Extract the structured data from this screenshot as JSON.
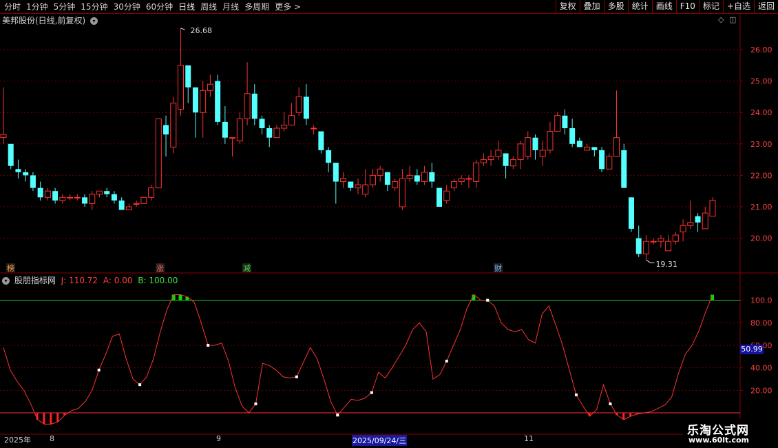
{
  "toolbar": {
    "periods": [
      "分时",
      "1分钟",
      "5分钟",
      "15分钟",
      "30分钟",
      "60分钟",
      "日线",
      "周线",
      "月线",
      "多周期",
      "更多 >"
    ],
    "active_period": "日线",
    "right_buttons": [
      "复权",
      "叠加",
      "多股",
      "统计",
      "画线",
      "F10",
      "标记",
      "+自选",
      "返回"
    ]
  },
  "stock_title": "美邦股份(日线,前复权)",
  "main_chart": {
    "y_ticks": [
      "26.00",
      "25.00",
      "24.00",
      "23.00",
      "22.00",
      "21.00",
      "20.00"
    ],
    "high_label": "26.68",
    "low_label": "19.31",
    "markers": [
      {
        "text": "榜",
        "color": "#ff9c3a"
      },
      {
        "text": "涨",
        "color": "#ff6060"
      },
      {
        "text": "减",
        "color": "#40e040"
      },
      {
        "text": "财",
        "color": "#7ab0ff"
      }
    ],
    "colors": {
      "up": "#ff3232",
      "down": "#54ffff",
      "grid": "#700000"
    },
    "candles": [
      [
        23.2,
        23.3,
        24.8,
        23.0
      ],
      [
        23.0,
        22.3,
        23.0,
        22.2
      ],
      [
        22.2,
        22.1,
        22.5,
        21.9
      ],
      [
        22.1,
        22.0,
        22.2,
        21.8
      ],
      [
        22.0,
        21.6,
        22.1,
        21.5
      ],
      [
        21.6,
        21.3,
        21.8,
        21.2
      ],
      [
        21.3,
        21.5,
        21.6,
        21.2
      ],
      [
        21.5,
        21.2,
        21.6,
        21.1
      ],
      [
        21.2,
        21.3,
        21.4,
        21.1
      ],
      [
        21.3,
        21.3,
        21.4,
        21.2
      ],
      [
        21.3,
        21.3,
        21.4,
        21.2
      ],
      [
        21.3,
        21.1,
        21.4,
        21.0
      ],
      [
        21.1,
        21.4,
        21.5,
        20.9
      ],
      [
        21.4,
        21.5,
        21.5,
        21.3
      ],
      [
        21.5,
        21.4,
        21.6,
        21.3
      ],
      [
        21.4,
        21.2,
        21.5,
        21.1
      ],
      [
        21.2,
        20.9,
        21.3,
        20.9
      ],
      [
        20.9,
        21.0,
        21.1,
        20.9
      ],
      [
        21.1,
        21.1,
        21.2,
        21.0
      ],
      [
        21.1,
        21.3,
        21.3,
        21.1
      ],
      [
        21.3,
        21.6,
        21.7,
        21.2
      ],
      [
        21.6,
        23.8,
        23.8,
        21.6
      ],
      [
        23.6,
        23.3,
        23.9,
        22.6
      ],
      [
        22.9,
        24.3,
        24.5,
        22.7
      ],
      [
        24.1,
        25.5,
        26.68,
        23.9
      ],
      [
        25.5,
        24.8,
        25.3,
        24.3
      ],
      [
        24.8,
        24.0,
        24.7,
        23.2
      ],
      [
        24.0,
        24.7,
        25.0,
        23.2
      ],
      [
        24.7,
        24.9,
        25.2,
        24.5
      ],
      [
        25.0,
        23.7,
        25.2,
        23.6
      ],
      [
        23.7,
        23.2,
        24.2,
        23.0
      ],
      [
        23.2,
        23.2,
        23.2,
        22.6
      ],
      [
        23.1,
        23.8,
        24.0,
        23.0
      ],
      [
        23.8,
        24.6,
        25.6,
        23.6
      ],
      [
        24.6,
        23.8,
        24.9,
        23.6
      ],
      [
        23.8,
        23.5,
        23.9,
        23.3
      ],
      [
        23.5,
        23.2,
        23.6,
        22.9
      ],
      [
        23.2,
        23.5,
        23.6,
        23.3
      ],
      [
        23.5,
        23.6,
        24.0,
        23.4
      ],
      [
        23.6,
        23.9,
        24.3,
        23.6
      ],
      [
        24.0,
        24.5,
        24.8,
        23.9
      ],
      [
        24.5,
        23.8,
        24.9,
        23.6
      ],
      [
        23.5,
        23.5,
        23.6,
        23.3
      ],
      [
        23.4,
        22.8,
        23.4,
        22.7
      ],
      [
        22.8,
        22.4,
        22.9,
        22.1
      ],
      [
        22.4,
        21.8,
        22.4,
        21.1
      ],
      [
        21.8,
        21.9,
        22.1,
        21.6
      ],
      [
        21.8,
        21.6,
        21.8,
        21.5
      ],
      [
        21.6,
        21.7,
        21.9,
        21.4
      ],
      [
        21.4,
        21.7,
        22.2,
        21.3
      ],
      [
        21.7,
        22.0,
        22.2,
        21.6
      ],
      [
        22.0,
        22.2,
        22.3,
        21.8
      ],
      [
        22.1,
        21.7,
        22.1,
        21.5
      ],
      [
        21.6,
        21.8,
        21.9,
        21.5
      ],
      [
        21.0,
        21.9,
        22.2,
        20.9
      ],
      [
        21.9,
        22.0,
        22.3,
        21.8
      ],
      [
        22.0,
        21.8,
        22.2,
        21.7
      ],
      [
        21.8,
        22.1,
        22.3,
        21.7
      ],
      [
        22.1,
        21.8,
        22.4,
        21.6
      ],
      [
        21.6,
        21.0,
        21.6,
        21.0
      ],
      [
        21.2,
        21.5,
        21.7,
        21.1
      ],
      [
        21.6,
        21.8,
        21.9,
        21.5
      ],
      [
        21.8,
        21.9,
        22.0,
        21.7
      ],
      [
        21.9,
        21.9,
        22.0,
        21.6
      ],
      [
        21.8,
        22.4,
        22.5,
        21.6
      ],
      [
        22.4,
        22.5,
        22.7,
        22.3
      ],
      [
        22.5,
        22.6,
        22.8,
        22.3
      ],
      [
        22.6,
        22.8,
        23.1,
        22.5
      ],
      [
        22.7,
        22.3,
        22.7,
        21.9
      ],
      [
        22.3,
        22.5,
        22.6,
        22.2
      ],
      [
        22.5,
        23.0,
        23.1,
        22.2
      ],
      [
        22.6,
        23.2,
        23.4,
        22.5
      ],
      [
        23.2,
        22.8,
        23.3,
        22.5
      ],
      [
        22.6,
        22.8,
        23.1,
        22.3
      ],
      [
        22.8,
        23.4,
        23.7,
        22.7
      ],
      [
        23.4,
        23.9,
        24.0,
        23.4
      ],
      [
        23.9,
        23.5,
        24.1,
        23.3
      ],
      [
        23.5,
        23.0,
        23.8,
        22.9
      ],
      [
        23.1,
        22.9,
        23.2,
        22.9
      ],
      [
        22.8,
        22.9,
        23.0,
        22.8
      ],
      [
        22.9,
        22.8,
        22.9,
        22.6
      ],
      [
        22.8,
        22.2,
        22.9,
        22.1
      ],
      [
        22.2,
        22.6,
        22.7,
        22.2
      ],
      [
        22.6,
        23.2,
        24.7,
        22.6
      ],
      [
        22.8,
        21.6,
        23.0,
        21.6
      ],
      [
        21.3,
        20.3,
        21.3,
        20.2
      ],
      [
        20.0,
        19.5,
        20.4,
        19.4
      ],
      [
        19.5,
        19.9,
        20.1,
        19.31
      ],
      [
        19.9,
        19.9,
        20.0,
        19.8
      ],
      [
        19.9,
        20.0,
        20.1,
        19.7
      ],
      [
        19.6,
        19.9,
        20.1,
        19.6
      ],
      [
        19.9,
        20.1,
        20.2,
        19.8
      ],
      [
        20.2,
        20.4,
        20.6,
        19.9
      ],
      [
        20.4,
        20.5,
        21.2,
        20.3
      ],
      [
        20.7,
        20.5,
        20.8,
        20.2
      ],
      [
        20.3,
        20.8,
        21.0,
        20.3
      ],
      [
        20.7,
        21.2,
        21.3,
        20.7
      ]
    ]
  },
  "indicator": {
    "name": "股朋指标网",
    "j_label": "J: 110.72",
    "a_label": "A: 0.00",
    "b_label": "B: 100.00",
    "y_ticks": [
      "100.0",
      "80.00",
      "60.00",
      "40.00",
      "20.00"
    ],
    "current_value": "50.99",
    "colors": {
      "line": "#ff3232",
      "bar_up": "#00e000",
      "bar_down": "#ff2020",
      "ref": "#20d020"
    },
    "j_values": [
      58,
      38,
      28,
      20,
      8,
      -6,
      -10,
      -10,
      -8,
      -2,
      2,
      4,
      10,
      20,
      38,
      52,
      68,
      70,
      48,
      30,
      25,
      32,
      48,
      72,
      92,
      105,
      105,
      103,
      98,
      80,
      60,
      60,
      62,
      46,
      22,
      6,
      0,
      8,
      44,
      42,
      38,
      32,
      31,
      32,
      45,
      58,
      48,
      30,
      10,
      -2,
      5,
      12,
      11,
      13,
      18,
      36,
      31,
      40,
      50,
      60,
      74,
      80,
      72,
      30,
      34,
      46,
      60,
      74,
      93,
      105,
      100,
      100,
      95,
      80,
      74,
      72,
      74,
      65,
      62,
      88,
      95,
      78,
      60,
      38,
      16,
      6,
      -3,
      3,
      25,
      8,
      -2,
      -6,
      -3,
      -1,
      0,
      1,
      4,
      7,
      14,
      35,
      52,
      60,
      73,
      90,
      105
    ]
  },
  "date_axis": {
    "labels": [
      "2025年",
      "8",
      "9",
      "11"
    ],
    "highlight": "2025/09/24/三"
  },
  "watermark": {
    "title": "乐淘公式网",
    "url": "www.60lt.com"
  }
}
